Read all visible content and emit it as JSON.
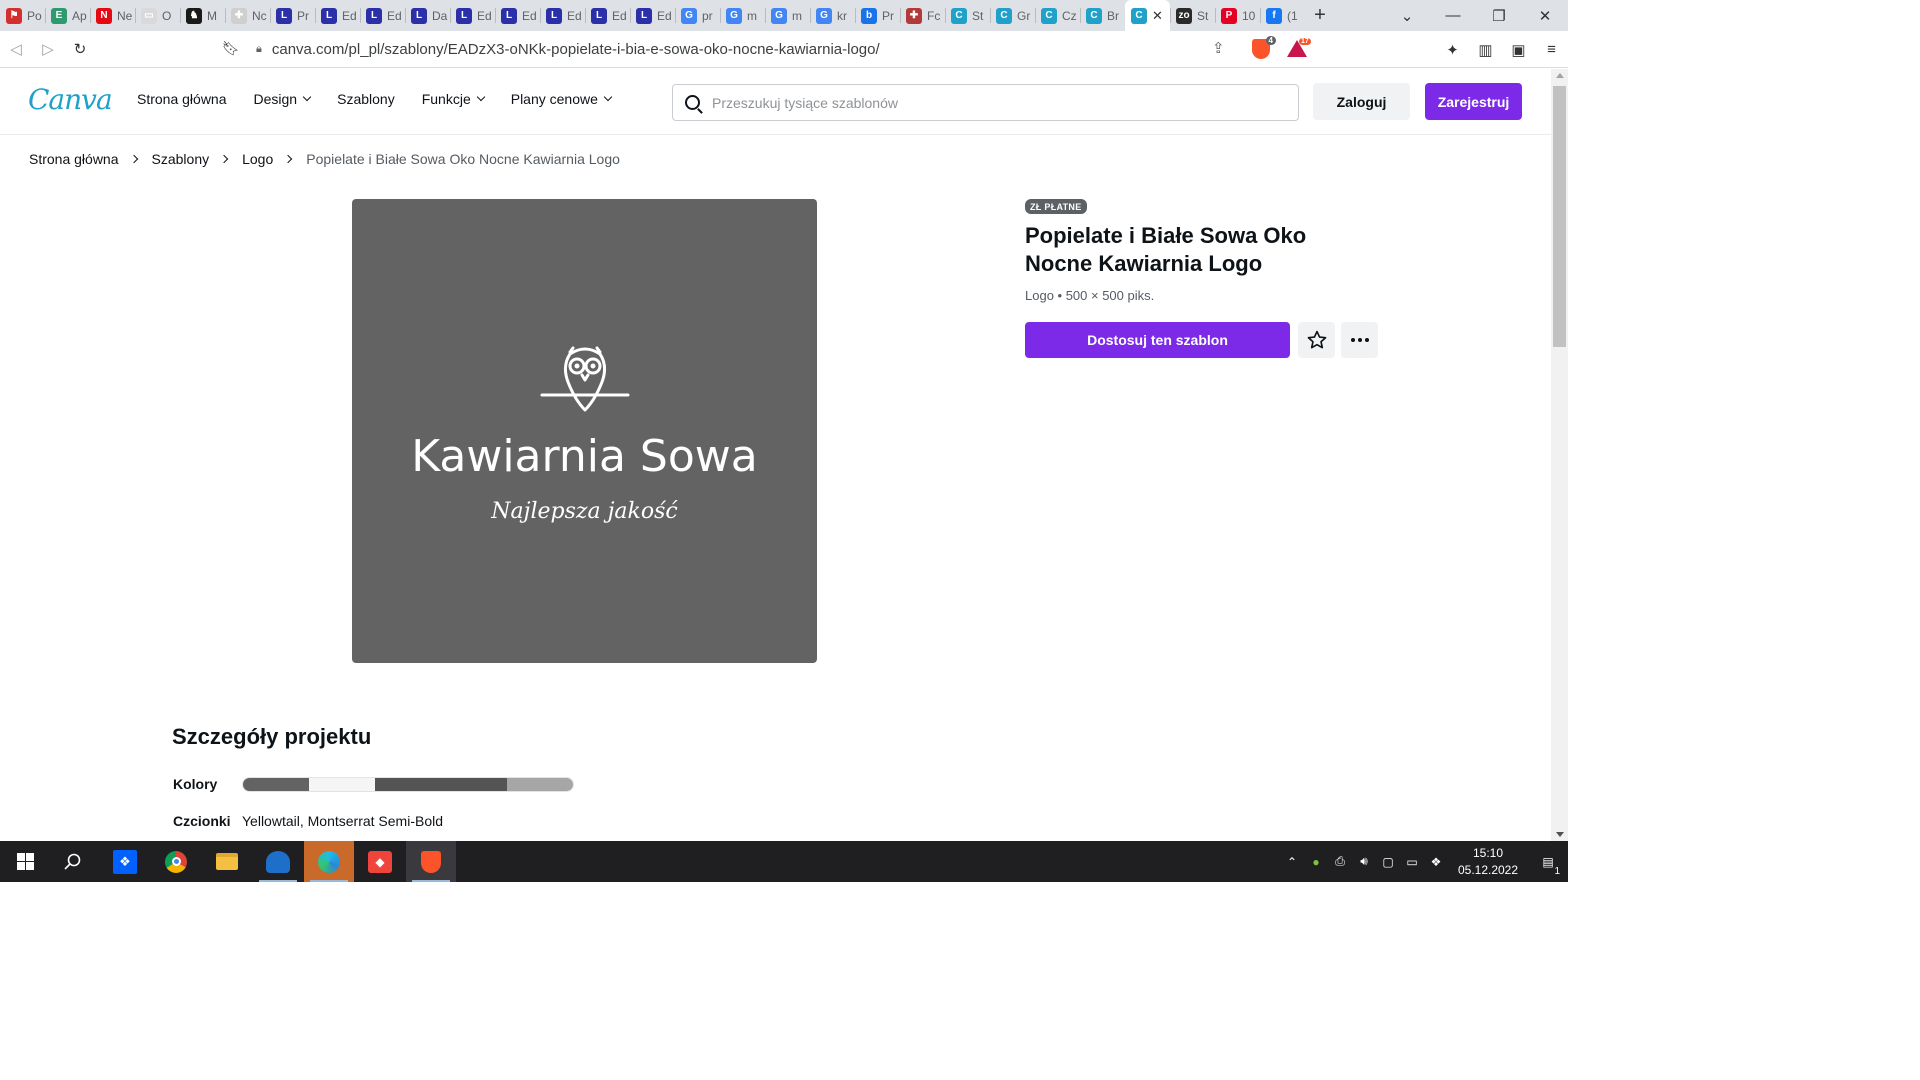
{
  "browser": {
    "tabs": [
      {
        "title": "Po",
        "fav_color": "#d32f2f",
        "fav_glyph": "⚑"
      },
      {
        "title": "Ap",
        "fav_color": "#2e9a6e",
        "fav_glyph": "E"
      },
      {
        "title": "Ne",
        "fav_color": "#e50914",
        "fav_glyph": "N"
      },
      {
        "title": "O",
        "fav_color": "#d9d9d9",
        "fav_glyph": "▭"
      },
      {
        "title": "M",
        "fav_color": "#1a1a1a",
        "fav_glyph": "♞"
      },
      {
        "title": "Nc",
        "fav_color": "#cfcfcf",
        "fav_glyph": "✚"
      },
      {
        "title": "Pr",
        "fav_color": "#2b2fa8",
        "fav_glyph": "L"
      },
      {
        "title": "Ed",
        "fav_color": "#2b2fa8",
        "fav_glyph": "L"
      },
      {
        "title": "Ed",
        "fav_color": "#2b2fa8",
        "fav_glyph": "L"
      },
      {
        "title": "Da",
        "fav_color": "#2b2fa8",
        "fav_glyph": "L"
      },
      {
        "title": "Ed",
        "fav_color": "#2b2fa8",
        "fav_glyph": "L"
      },
      {
        "title": "Ed",
        "fav_color": "#2b2fa8",
        "fav_glyph": "L"
      },
      {
        "title": "Ed",
        "fav_color": "#2b2fa8",
        "fav_glyph": "L"
      },
      {
        "title": "Ed",
        "fav_color": "#2b2fa8",
        "fav_glyph": "L"
      },
      {
        "title": "Ed",
        "fav_color": "#2b2fa8",
        "fav_glyph": "L"
      },
      {
        "title": "pr",
        "fav_color": "#4285f4",
        "fav_glyph": "G"
      },
      {
        "title": "m",
        "fav_color": "#4285f4",
        "fav_glyph": "G"
      },
      {
        "title": "m",
        "fav_color": "#4285f4",
        "fav_glyph": "G"
      },
      {
        "title": "kr",
        "fav_color": "#4285f4",
        "fav_glyph": "G"
      },
      {
        "title": "Pr",
        "fav_color": "#1a73e8",
        "fav_glyph": "b"
      },
      {
        "title": "Fc",
        "fav_color": "#b33a3a",
        "fav_glyph": "✚"
      },
      {
        "title": "St",
        "fav_color": "#1fa1c9",
        "fav_glyph": "C"
      },
      {
        "title": "Gr",
        "fav_color": "#1fa1c9",
        "fav_glyph": "C"
      },
      {
        "title": "Cz",
        "fav_color": "#1fa1c9",
        "fav_glyph": "C"
      },
      {
        "title": "Br",
        "fav_color": "#1fa1c9",
        "fav_glyph": "C"
      },
      {
        "title": "",
        "fav_color": "#1fa1c9",
        "fav_glyph": "C",
        "active": true
      },
      {
        "title": "St",
        "fav_color": "#2a2a2a",
        "fav_glyph": "zo"
      },
      {
        "title": "10",
        "fav_color": "#e60023",
        "fav_glyph": "P"
      },
      {
        "title": "(1",
        "fav_color": "#1877f2",
        "fav_glyph": "f"
      }
    ],
    "new_tab_label": "+",
    "url": "canva.com/pl_pl/szablony/EADzX3-oNKk-popielate-i-bia-e-sowa-oko-nocne-kawiarnia-logo/",
    "shield_count": "4",
    "rewards_count": "17"
  },
  "header": {
    "logo_text": "Canva",
    "nav": [
      {
        "label": "Strona główna",
        "dropdown": false
      },
      {
        "label": "Design",
        "dropdown": true
      },
      {
        "label": "Szablony",
        "dropdown": false
      },
      {
        "label": "Funkcje",
        "dropdown": true
      },
      {
        "label": "Plany cenowe",
        "dropdown": true
      }
    ],
    "search_placeholder": "Przeszukuj tysiące szablonów",
    "login_label": "Zaloguj",
    "signup_label": "Zarejestruj"
  },
  "breadcrumb": [
    "Strona główna",
    "Szablony",
    "Logo"
  ],
  "breadcrumb_current": "Popielate i Białe Sowa Oko Nocne Kawiarnia Logo",
  "preview": {
    "background": "#636363",
    "brand_name": "Kawiarnia Sowa",
    "tagline": "Najlepsza jakość"
  },
  "template": {
    "badge": "ZŁ PŁATNE",
    "title": "Popielate i Białe Sowa Oko Nocne Kawiarnia Logo",
    "meta": "Logo • 500 × 500 piks.",
    "customize_label": "Dostosuj ten szablon"
  },
  "details": {
    "heading": "Szczegóły projektu",
    "colors_label": "Kolory",
    "palette": [
      "#636363",
      "#f5f5f5",
      "#545454",
      "#545454",
      "#a6a6a6"
    ],
    "fonts_label": "Czcionki",
    "fonts_value": "Yellowtail, Montserrat Semi-Bold"
  },
  "taskbar": {
    "time": "15:10",
    "date": "05.12.2022",
    "notification_count": "1"
  },
  "colors": {
    "accent": "#7d2ae8",
    "canva_blue": "#1fa1c9"
  }
}
